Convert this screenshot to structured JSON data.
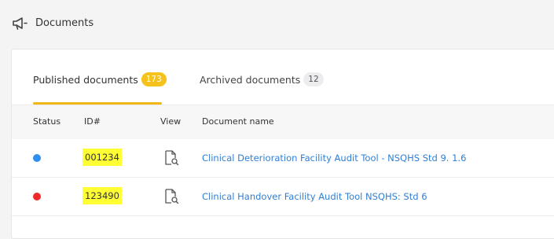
{
  "header": {
    "title": "Documents",
    "icon": "megaphone-icon"
  },
  "tabs": [
    {
      "label": "Published documents",
      "count": "173",
      "active": true,
      "badge_color": "#f5c21b"
    },
    {
      "label": "Archived documents",
      "count": "12",
      "active": false,
      "badge_color": "#ededef"
    }
  ],
  "table": {
    "columns": [
      "Status",
      "ID#",
      "View",
      "Document name"
    ],
    "rows": [
      {
        "status_color": "#2f8ff0",
        "id": "001234",
        "view_icon": "document-search-icon",
        "name": "Clinical Deterioration Facility Audit Tool - NSQHS Std 9. 1.6"
      },
      {
        "status_color": "#f02a2a",
        "id": "123490",
        "view_icon": "document-search-icon",
        "name": "Clinical Handover Facility Audit Tool NSQHS: Std 6"
      }
    ]
  },
  "colors": {
    "accent": "#f0b716",
    "link": "#2f7fd6",
    "highlight": "#ffff33"
  }
}
